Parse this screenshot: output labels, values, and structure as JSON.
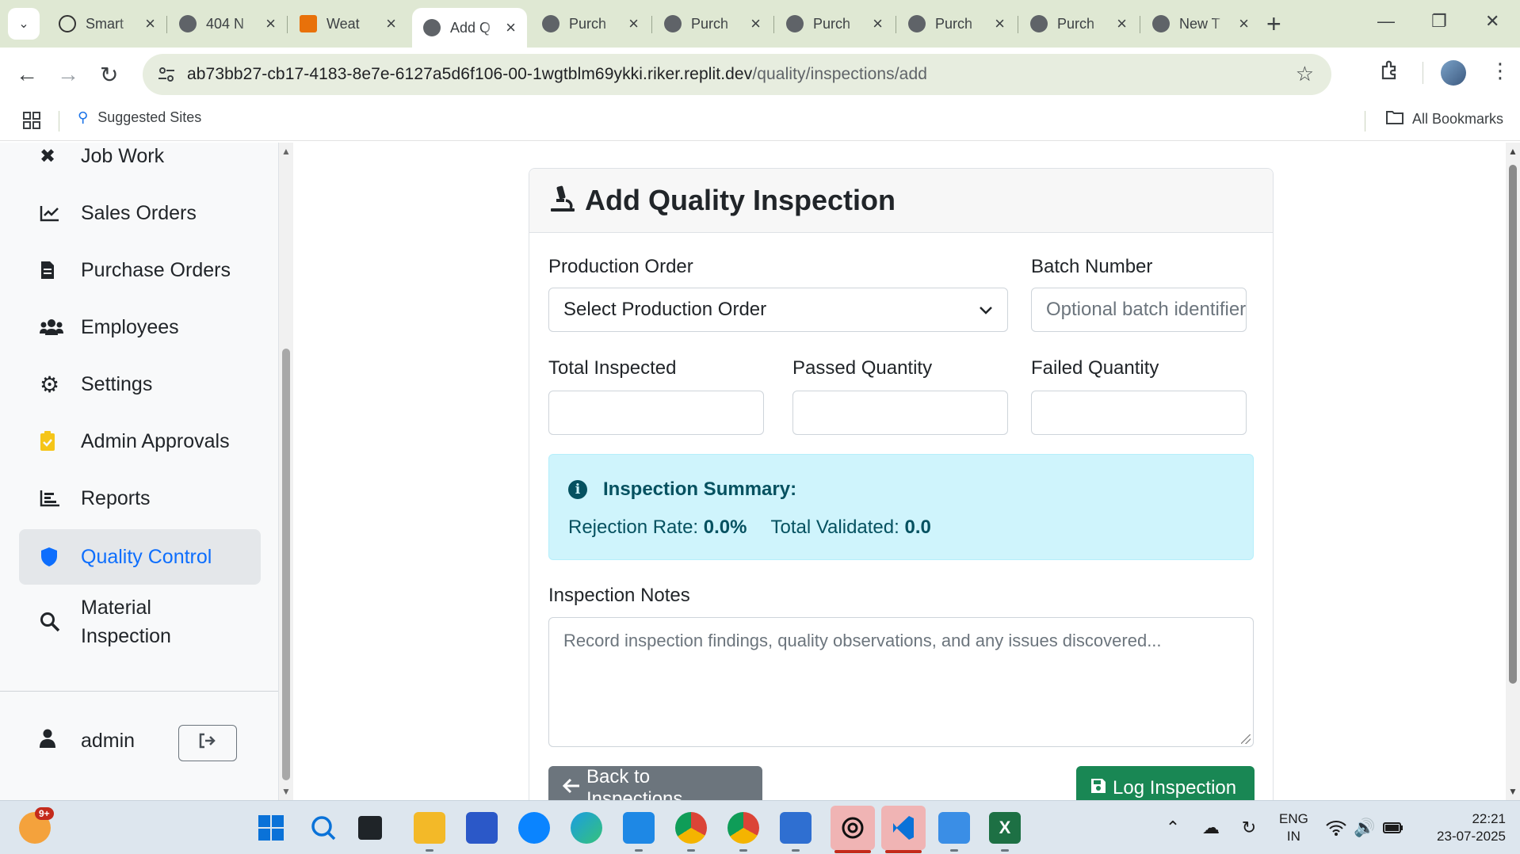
{
  "browser": {
    "tabs": [
      {
        "title": "Smart"
      },
      {
        "title": "404 N"
      },
      {
        "title": "Weat"
      },
      {
        "title": "Add Q"
      },
      {
        "title": "Purch"
      },
      {
        "title": "Purch"
      },
      {
        "title": "Purch"
      },
      {
        "title": "Purch"
      },
      {
        "title": "Purch"
      },
      {
        "title": "New T"
      }
    ],
    "url_host": "ab73bb27-cb17-4183-8e7e-6127a5d6f106-00-1wgtblm69ykki.riker.replit.dev",
    "url_path": "/quality/inspections/add",
    "bookmarks": {
      "suggested": "Suggested Sites",
      "all": "All Bookmarks"
    }
  },
  "sidebar": {
    "items": [
      {
        "label": "Job Work",
        "icon": "tools-icon"
      },
      {
        "label": "Sales Orders",
        "icon": "chart-line-icon"
      },
      {
        "label": "Purchase Orders",
        "icon": "file-invoice-icon"
      },
      {
        "label": "Employees",
        "icon": "users-icon"
      },
      {
        "label": "Settings",
        "icon": "gear-icon"
      },
      {
        "label": "Admin Approvals",
        "icon": "clipboard-check-icon"
      },
      {
        "label": "Reports",
        "icon": "chart-bar-icon"
      },
      {
        "label": "Quality Control",
        "icon": "shield-icon"
      },
      {
        "label": "Material Inspection",
        "icon": "search-icon"
      }
    ],
    "user": "admin"
  },
  "form": {
    "title": "Add Quality Inspection",
    "production_order_label": "Production Order",
    "production_order_value": "Select Production Order",
    "batch_label": "Batch Number",
    "batch_placeholder": "Optional batch identifier",
    "total_label": "Total Inspected",
    "passed_label": "Passed Quantity",
    "failed_label": "Failed Quantity",
    "summary_title": "Inspection Summary:",
    "rejection_label": "Rejection Rate:",
    "rejection_value": "0.0%",
    "validated_label": "Total Validated:",
    "validated_value": "0.0",
    "notes_label": "Inspection Notes",
    "notes_placeholder": "Record inspection findings, quality observations, and any issues discovered...",
    "back_button": "Back to Inspections",
    "log_button": "Log Inspection"
  },
  "taskbar": {
    "notification_badge": "9+",
    "lang_line1": "ENG",
    "lang_line2": "IN",
    "time": "22:21",
    "date": "23-07-2025"
  },
  "colors": {
    "accent": "#0d6efd",
    "success": "#198754",
    "secondary": "#6c757d",
    "info_bg": "#cff4fc",
    "chrome_bg": "#dfe8d3"
  }
}
